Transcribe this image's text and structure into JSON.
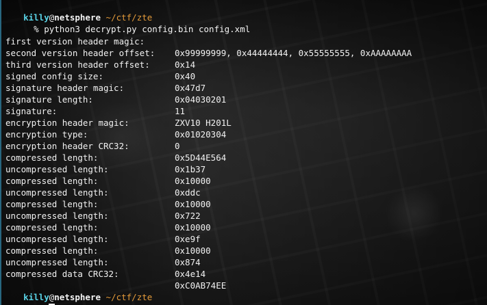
{
  "terminal": {
    "session": {
      "prompt": {
        "user": "killy",
        "at": "@",
        "host": "netsphere",
        "path": " ~/ctf/zte"
      },
      "command_prefix": "  % ",
      "command": "python3 decrypt.py config.bin config.xml",
      "output": [
        {
          "key": "first version header magic:",
          "value": "0x99999999, 0x44444444, 0x55555555, 0xAAAAAAAA"
        },
        {
          "key": "second version header offset:",
          "value": "0x14"
        },
        {
          "key": "third version header offset:",
          "value": "0x40"
        },
        {
          "key": "signed config size:",
          "value": "0x47d7"
        },
        {
          "key": "signature header magic:",
          "value": "0x04030201"
        },
        {
          "key": "signature length:",
          "value": "11"
        },
        {
          "key": "signature:",
          "value": "ZXV10 H201L"
        },
        {
          "key": "encryption header magic:",
          "value": "0x01020304"
        },
        {
          "key": "encryption type:",
          "value": "0"
        },
        {
          "key": "encryption header CRC32:",
          "value": "0x5D44E564"
        },
        {
          "key": "compressed length:",
          "value": "0x1b37"
        },
        {
          "key": "uncompressed length:",
          "value": "0x10000"
        },
        {
          "key": "compressed length:",
          "value": "0xddc"
        },
        {
          "key": "uncompressed length:",
          "value": "0x10000"
        },
        {
          "key": "compressed length:",
          "value": "0x722"
        },
        {
          "key": "uncompressed length:",
          "value": "0x10000"
        },
        {
          "key": "compressed length:",
          "value": "0xe9f"
        },
        {
          "key": "uncompressed length:",
          "value": "0x10000"
        },
        {
          "key": "compressed length:",
          "value": "0x874"
        },
        {
          "key": "uncompressed length:",
          "value": "0x4e14"
        },
        {
          "key": "compressed data CRC32:",
          "value": "0xC0AB74EE"
        }
      ],
      "next_prompt": {
        "user": "killy",
        "at": "@",
        "host": "netsphere",
        "path": " ~/ctf/zte",
        "input_prefix": "  % "
      }
    },
    "colors": {
      "user": "#59d3e6",
      "path": "#e39a3a",
      "text": "#f2f2f2",
      "left_bar": "#2a6b86"
    }
  }
}
